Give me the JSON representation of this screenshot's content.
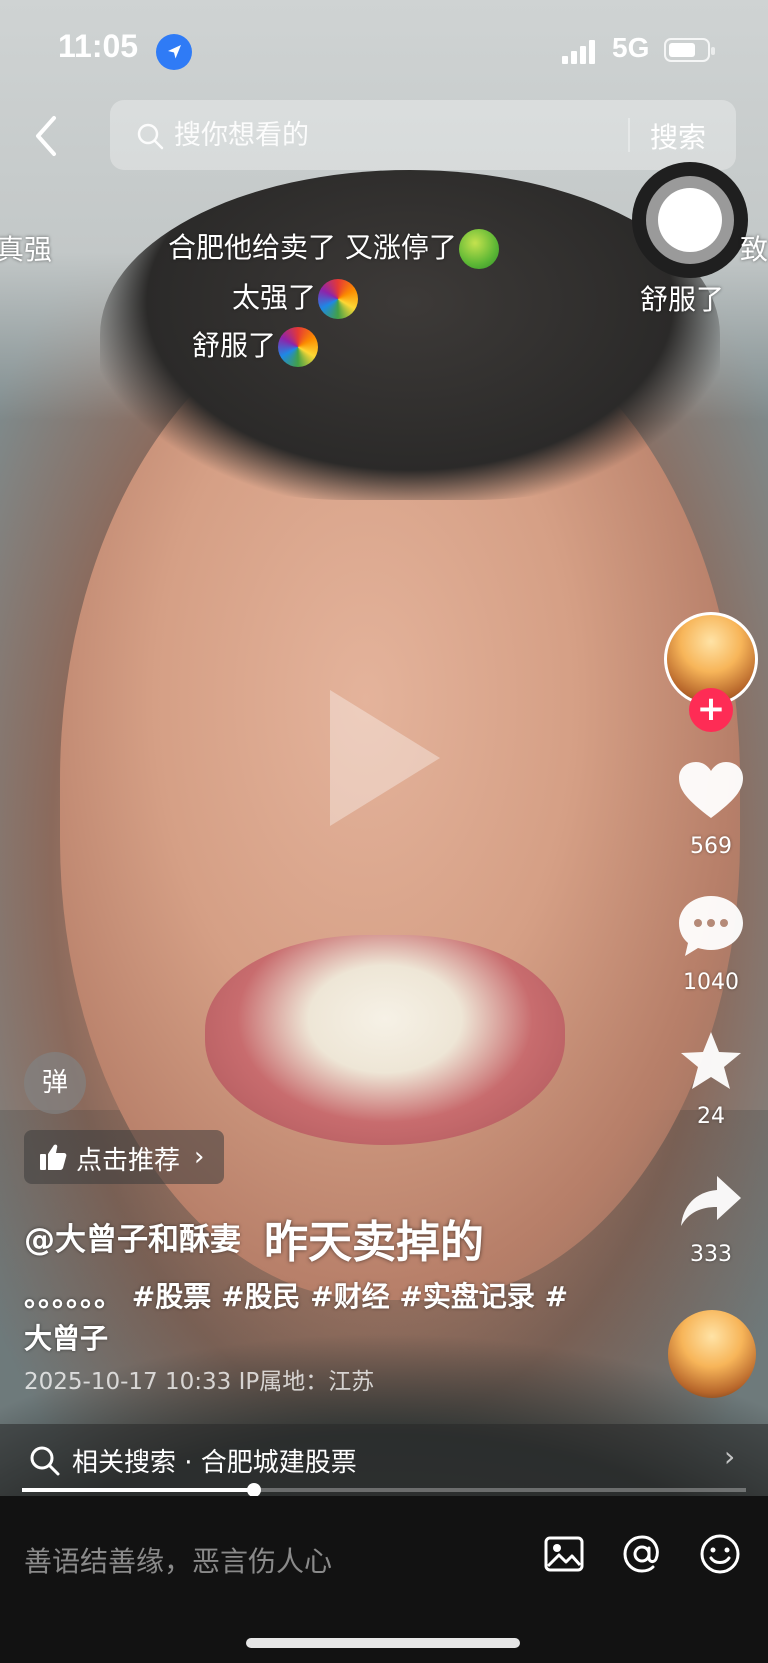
{
  "status_bar": {
    "time": "11:05",
    "network": "5G"
  },
  "search": {
    "placeholder": "搜你想看的",
    "button": "搜索"
  },
  "danmaku": [
    {
      "text": "真强"
    },
    {
      "text": "合肥他给卖了  又涨停了"
    },
    {
      "text": "太强了"
    },
    {
      "text": "舒服了"
    },
    {
      "text": "舒服了"
    },
    {
      "text": "致"
    }
  ],
  "actions": {
    "likes": "569",
    "comments": "1040",
    "favorites": "24",
    "shares": "333"
  },
  "danmu_toggle": "弹",
  "recommend": {
    "label": "点击推荐"
  },
  "video": {
    "author": "@大曾子和酥妻",
    "title": "昨天卖掉的",
    "description": "。。。。。。  #股票 #股民 #财经 #实盘记录 #大曾子",
    "meta": "2025-10-17 10:33   IP属地：江苏"
  },
  "related_search": {
    "text": "相关搜索 · 合肥城建股票"
  },
  "playback": {
    "progress_fraction": 0.32
  },
  "comment": {
    "placeholder": "善语结善缘，恶言伤人心"
  },
  "colors": {
    "accent": "#fe2c55",
    "location_blue": "#2f7bf6"
  }
}
